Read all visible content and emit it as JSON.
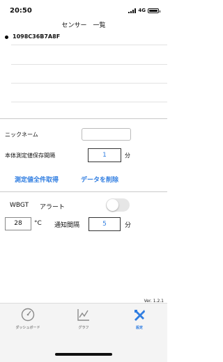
{
  "status_bar": {
    "time": "20:50",
    "network": "4G"
  },
  "header": {
    "title": "センサー　一覧"
  },
  "sensors": [
    {
      "name": "1098C36B7A8F",
      "selected": true
    }
  ],
  "settings": {
    "nickname_label": "ニックネーム",
    "nickname_value": "",
    "interval_label": "本体測定値保存間隔",
    "interval_value": "1",
    "interval_unit": "分",
    "fetch_all_label": "測定値全件取得",
    "delete_data_label": "データを削除"
  },
  "alert": {
    "wbgt_label": "WBGT",
    "alert_label": "アラート",
    "enabled": false,
    "threshold_value": "28",
    "threshold_unit": "°C",
    "notify_interval_label": "通知間隔",
    "notify_interval_value": "5",
    "notify_interval_unit": "分"
  },
  "version": "Ver. 1.2.1",
  "tabbar": {
    "tabs": [
      {
        "label": "ダッシュボード",
        "icon": "gauge-icon",
        "active": false
      },
      {
        "label": "グラフ",
        "icon": "chart-icon",
        "active": false
      },
      {
        "label": "設定",
        "icon": "tools-icon",
        "active": true
      }
    ]
  },
  "colors": {
    "accent": "#2f7de1",
    "tab_inactive": "#888888",
    "toggle_off": "#e6e6e6"
  }
}
